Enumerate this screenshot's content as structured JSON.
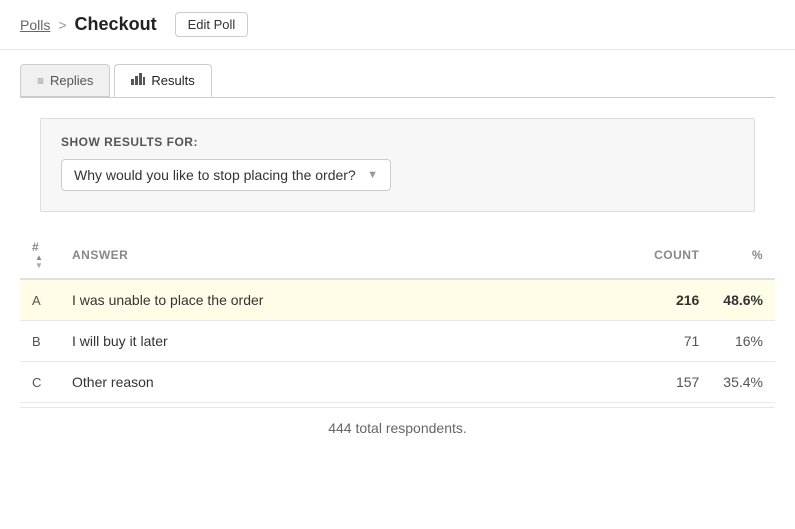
{
  "breadcrumb": {
    "polls_label": "Polls",
    "separator": ">",
    "current_page": "Checkout"
  },
  "header": {
    "edit_poll_label": "Edit Poll"
  },
  "tabs": [
    {
      "id": "replies",
      "label": "Replies",
      "icon": "≡",
      "active": false
    },
    {
      "id": "results",
      "label": "Results",
      "icon": "📊",
      "active": true
    }
  ],
  "show_results": {
    "label": "SHOW RESULTS FOR:",
    "question": "Why would you like to stop placing the order?"
  },
  "table": {
    "columns": {
      "number": "#",
      "answer": "ANSWER",
      "count": "COUNT",
      "pct": "%"
    },
    "rows": [
      {
        "letter": "A",
        "answer": "I was unable to place the order",
        "count": "216",
        "pct": "48.6%",
        "highlight": true
      },
      {
        "letter": "B",
        "answer": "I will buy it later",
        "count": "71",
        "pct": "16%",
        "highlight": false
      },
      {
        "letter": "C",
        "answer": "Other reason",
        "count": "157",
        "pct": "35.4%",
        "highlight": false
      }
    ],
    "total_respondents": "444 total respondents."
  }
}
